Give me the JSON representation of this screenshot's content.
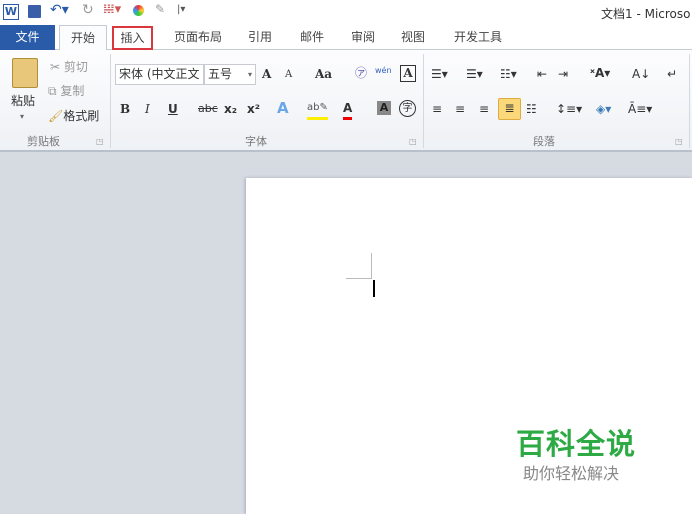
{
  "title": "文档1 - Microso",
  "quick_access": {
    "word_icon": "W",
    "save": "save-icon",
    "undo": "undo-icon",
    "redo": "redo-icon"
  },
  "tabs": [
    {
      "label": "文件"
    },
    {
      "label": "开始"
    },
    {
      "label": "插入"
    },
    {
      "label": "页面布局"
    },
    {
      "label": "引用"
    },
    {
      "label": "邮件"
    },
    {
      "label": "审阅"
    },
    {
      "label": "视图"
    },
    {
      "label": "开发工具"
    }
  ],
  "clipboard": {
    "paste": "粘贴",
    "cut": "剪切",
    "copy": "复制",
    "format_painter": "格式刷",
    "label": "剪贴板"
  },
  "font": {
    "name": "宋体 (中文正文",
    "size": "五号",
    "grow": "A",
    "shrink": "A",
    "case": "Aa",
    "bold": "B",
    "italic": "I",
    "underline": "U",
    "strike": "abc",
    "sub": "x₂",
    "sup": "x²",
    "label": "字体",
    "wen": "wén",
    "charA": "A",
    "zi": "字"
  },
  "paragraph": {
    "label": "段落"
  },
  "watermark": {
    "title": "百科全说",
    "subtitle": "助你轻松解决"
  },
  "colors": {
    "file_tab": "#2a5ba8",
    "highlight_box": "#d9363e",
    "watermark": "#2eaa44"
  }
}
